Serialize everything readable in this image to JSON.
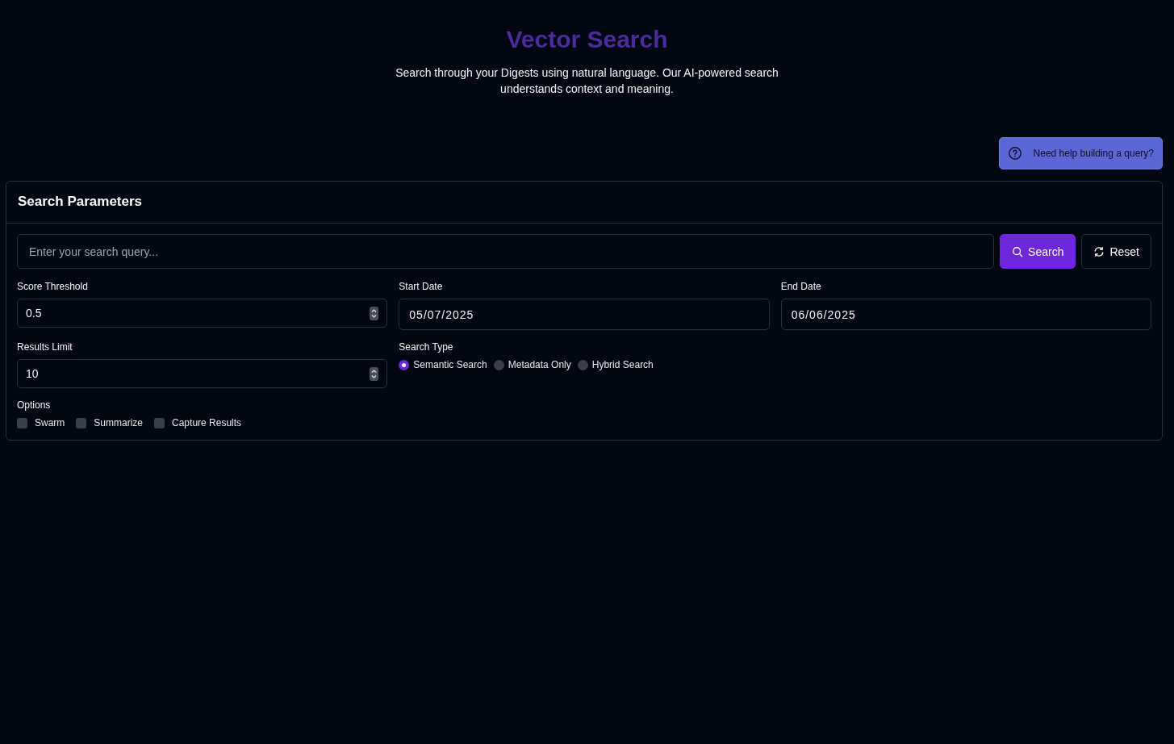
{
  "header": {
    "title": "Vector Search",
    "subtitle": "Search through your Digests using natural language. Our AI-powered search understands context and meaning."
  },
  "help_button": {
    "label": "Need help building a query?"
  },
  "panel": {
    "title": "Search Parameters",
    "query": {
      "placeholder": "Enter your search query..."
    },
    "buttons": [
      {
        "label": "Search",
        "kind": "primary"
      },
      {
        "label": "Reset",
        "kind": "secondary"
      }
    ],
    "fields": [
      {
        "label": "Score Threshold",
        "value": "0.5",
        "kind": "number"
      },
      {
        "label": "Start Date",
        "value": "05/07/2025",
        "kind": "date"
      },
      {
        "label": "End Date",
        "value": "06/06/2025",
        "kind": "date"
      },
      {
        "label": "Results Limit",
        "value": "10",
        "kind": "number"
      }
    ],
    "search_type": {
      "label": "Search Type",
      "options": [
        {
          "label": "Semantic Search",
          "selected": true
        },
        {
          "label": "Metadata Only",
          "selected": false
        },
        {
          "label": "Hybrid Search",
          "selected": false
        }
      ]
    },
    "options": {
      "label": "Options",
      "items": [
        {
          "label": "Swarm",
          "checked": false
        },
        {
          "label": "Summarize",
          "checked": false
        },
        {
          "label": "Capture Results",
          "checked": false
        }
      ]
    }
  }
}
